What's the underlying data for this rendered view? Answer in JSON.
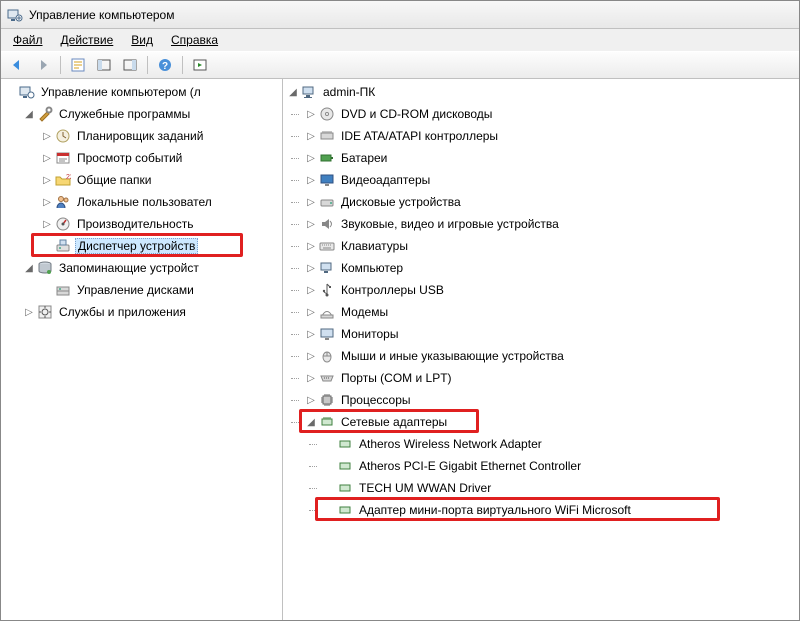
{
  "window": {
    "title": "Управление компьютером"
  },
  "menu": {
    "file": "Файл",
    "action": "Действие",
    "view": "Вид",
    "help": "Справка"
  },
  "toolbar_icons": {
    "back": "back-arrow",
    "forward": "forward-arrow",
    "properties": "properties",
    "panes": "panes",
    "help": "help",
    "play": "play"
  },
  "left_tree": {
    "root": "Управление компьютером (л",
    "system_tools": "Служебные программы",
    "task_scheduler": "Планировщик заданий",
    "event_viewer": "Просмотр событий",
    "shared_folders": "Общие папки",
    "local_users": "Локальные пользовател",
    "performance": "Производительность",
    "device_manager": "Диспетчер устройств",
    "storage": "Запоминающие устройст",
    "disk_mgmt": "Управление дисками",
    "services_apps": "Службы и приложения"
  },
  "right_tree": {
    "root": "admin-ПК",
    "dvd": "DVD и CD-ROM дисководы",
    "ide": "IDE ATA/ATAPI контроллеры",
    "batteries": "Батареи",
    "video": "Видеоадаптеры",
    "disk": "Дисковые устройства",
    "sound": "Звуковые, видео и игровые устройства",
    "keyboards": "Клавиатуры",
    "computer": "Компьютер",
    "usb": "Контроллеры USB",
    "modems": "Модемы",
    "monitors": "Мониторы",
    "mice": "Мыши и иные указывающие устройства",
    "ports": "Порты (COM и LPT)",
    "cpus": "Процессоры",
    "netadapters": "Сетевые адаптеры",
    "atheros_wifi": "Atheros Wireless Network Adapter",
    "atheros_pcie": "Atheros PCI-E Gigabit Ethernet Controller",
    "tech_wwan": "TECH UM WWAN Driver",
    "ms_vwifi": "Адаптер мини-порта виртуального WiFi Microsoft"
  }
}
